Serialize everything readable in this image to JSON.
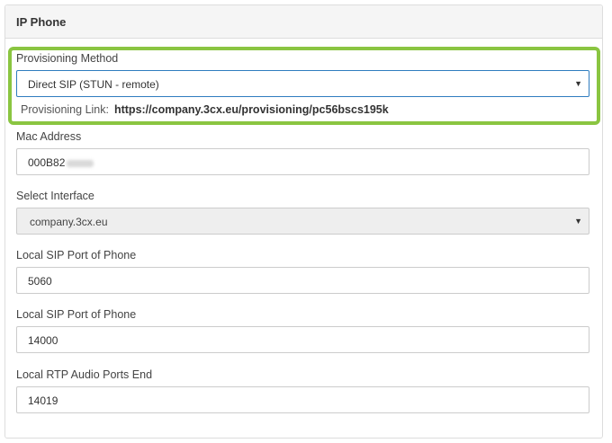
{
  "panel": {
    "title": "IP Phone"
  },
  "provisioning": {
    "label": "Provisioning Method",
    "selected": "Direct SIP (STUN - remote)",
    "link_label": "Provisioning Link:",
    "link_url": "https://company.3cx.eu/provisioning/pc56bscs195k"
  },
  "mac": {
    "label": "Mac Address",
    "value_visible": "000B82"
  },
  "interface": {
    "label": "Select Interface",
    "selected": "company.3cx.eu"
  },
  "sip_port_1": {
    "label": "Local SIP Port of Phone",
    "value": "5060"
  },
  "sip_port_2": {
    "label": "Local SIP Port of Phone",
    "value": "14000"
  },
  "rtp_end": {
    "label": "Local RTP Audio Ports End",
    "value": "14019"
  },
  "colors": {
    "highlight": "#8ac541",
    "focus_border": "#2f7dbf",
    "disabled_bg": "#eeeeee"
  },
  "icons": {
    "dropdown": "caret-down-icon"
  }
}
